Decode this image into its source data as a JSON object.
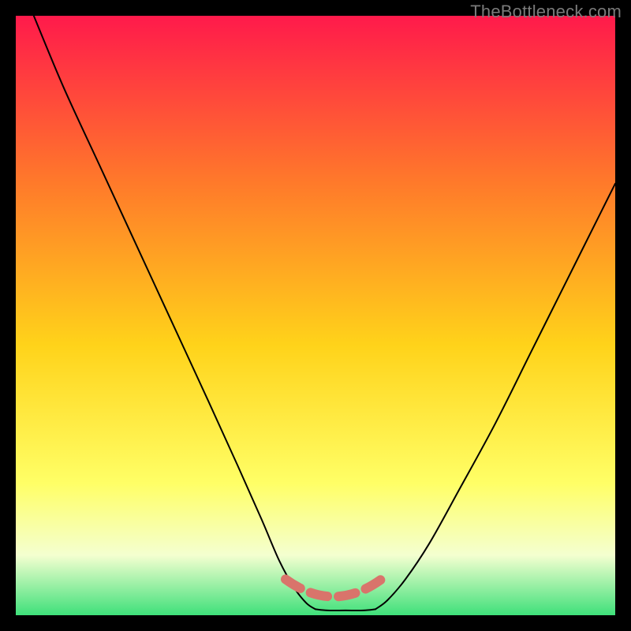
{
  "watermark": "TheBottleneck.com",
  "colors": {
    "gradient_top": "#ff1a4b",
    "gradient_mid1": "#ff7a2a",
    "gradient_mid2": "#ffd31a",
    "gradient_mid3": "#ffff66",
    "gradient_bottom_fade": "#f4ffd0",
    "gradient_green": "#3fe07a",
    "curve": "#000000",
    "dash": "#d9746b",
    "frame_bg": "#000000"
  },
  "chart_data": {
    "type": "line",
    "title": "",
    "xlabel": "",
    "ylabel": "",
    "xlim": [
      0,
      100
    ],
    "ylim": [
      0,
      100
    ],
    "series": [
      {
        "name": "left-curve",
        "x": [
          3,
          8,
          14,
          20,
          26,
          32,
          37,
          41,
          44,
          46.5,
          48.5,
          50
        ],
        "y": [
          100,
          88,
          75,
          62,
          49,
          36,
          25,
          16,
          9,
          4.5,
          2,
          1
        ]
      },
      {
        "name": "right-curve",
        "x": [
          60,
          62,
          65,
          69,
          74,
          80,
          86,
          92,
          98,
          100
        ],
        "y": [
          1,
          2.5,
          6,
          12,
          21,
          32,
          44,
          56,
          68,
          72
        ]
      },
      {
        "name": "flat-min",
        "x": [
          50,
          52,
          55,
          58,
          60
        ],
        "y": [
          1,
          0.8,
          0.8,
          0.8,
          1
        ]
      }
    ],
    "dash_segment": {
      "x": [
        45,
        61
      ],
      "y": [
        4,
        4
      ]
    }
  }
}
